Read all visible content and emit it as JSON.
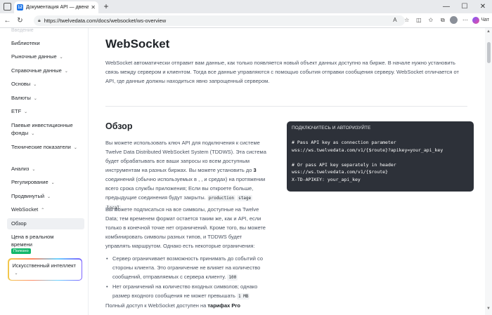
{
  "browser": {
    "tab_title": "Документация API — двенадцать",
    "tab_icon_text": "12",
    "url": "https://twelvedata.com/docs/websocket/ws-overview",
    "chat_label": "Чат"
  },
  "sidebar": {
    "faded_item": "Введение",
    "items": [
      {
        "label": "Библиотеки",
        "chevron": false
      },
      {
        "label": "Рыночные данные",
        "chevron": true
      },
      {
        "label": "Справочные данные",
        "chevron": true
      },
      {
        "label": "Основы",
        "chevron": true
      },
      {
        "label": "Валюты",
        "chevron": true
      },
      {
        "label": "ETF",
        "chevron": true
      },
      {
        "label": "Паевые инвестиционные фонды",
        "chevron": true
      },
      {
        "label": "Технические показатели",
        "chevron": true
      },
      {
        "label": "Анализ",
        "chevron": true
      },
      {
        "label": "Регулирование",
        "chevron": true
      },
      {
        "label": "Продвинутый",
        "chevron": true
      },
      {
        "label": "WebSocket",
        "chevron": true
      },
      {
        "label": "Обзор",
        "chevron": false
      },
      {
        "label": "Цена в реальном времени",
        "chevron": false
      }
    ],
    "useful_badge": "Полезно",
    "ai_card_label": "Искусственный интеллект"
  },
  "main": {
    "title": "WebSocket",
    "intro": "WebSocket автоматически отправит вам данные, как только появляется новый объект данных доступно на бирже. В начале нужно установить связь между сервером и клиентом. Тогда все данные управляются с помощью события отправки сообщения серверу. WebSocket отличается от API, где данные должны находиться явно запрощенный сервером.",
    "overview_heading": "Обзор",
    "para1_a": "Вы можете использовать ключ API для подключения к системе Twelve Data Distributed WebSocket System (TDDWS). Эта система будет обрабатывать все ваши запросы ко всем доступным инструментам на разных биржах. Вы можете установить до ",
    "para1_b": "3",
    "para1_c": " соединений (обычно используемых в , , и средах) на протяжении всего срока службы приложения; Если вы откроете больше, предыдущие соединения будут закрыты.",
    "env_codes": [
      "production",
      "stage",
      "local"
    ],
    "para2": "Вы можете подписаться на все символы, доступные на Twelve Data; тем временем формат остается таким же, как и API, если только в конечной точке нет ограничений. Кроме того, вы можете комбинировать символы разных типов, и TDDWS будет управлять маршрутом. Однако есть некоторые ограничения:",
    "bullet1": "Сервер ограничивает возможность принимать до событий со стороны клиента. Это ограничение не влияет на количество сообщений, отправляемых с сервера клиенту.",
    "bullet1_code": "100",
    "bullet2": "Нет ограничений на количество входных символов; однако размер входного сообщения не может превышать",
    "bullet2_code": "1 MB",
    "footer_a": "Полный доступ к WebSocket доступен на ",
    "footer_b": "тарифах Pro",
    "code_header": "ПОДКЛЮЧИТЕСЬ И АВТОРИЗУЙТЕ",
    "code_lines": [
      "# Pass API key as connection parameter",
      "wss://ws.twelvedata.com/v1/{$route}?apikey=your_api_key",
      "",
      "# Or pass API key separately in header",
      "wss://ws.twelvedata.com/v1/{$route}",
      "X-TD-APIKEY: your_api_key"
    ]
  },
  "colors": {
    "code_bg": "#2d3139",
    "badge_green": "#12b76a",
    "accent": "#1a73e8"
  }
}
